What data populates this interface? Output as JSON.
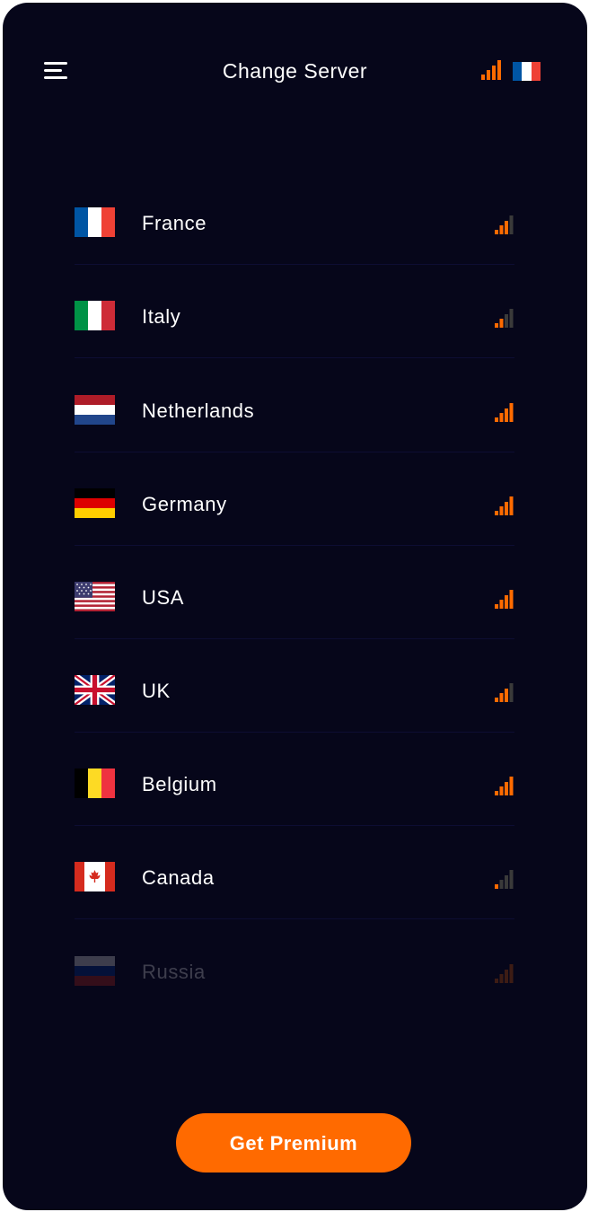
{
  "header": {
    "title": "Change Server",
    "menu_icon": "hamburger-menu-icon",
    "signal_icon": "signal-strength-icon",
    "current_flag": "France",
    "current_signal": 4
  },
  "servers": [
    {
      "country": "France",
      "flag": "france-flag-icon",
      "signal": 3
    },
    {
      "country": "Italy",
      "flag": "italy-flag-icon",
      "signal": 2
    },
    {
      "country": "Netherlands",
      "flag": "netherlands-flag-icon",
      "signal": 4
    },
    {
      "country": "Germany",
      "flag": "germany-flag-icon",
      "signal": 4
    },
    {
      "country": "USA",
      "flag": "usa-flag-icon",
      "signal": 4
    },
    {
      "country": "UK",
      "flag": "uk-flag-icon",
      "signal": 3
    },
    {
      "country": "Belgium",
      "flag": "belgium-flag-icon",
      "signal": 4
    },
    {
      "country": "Canada",
      "flag": "canada-flag-icon",
      "signal": 1
    },
    {
      "country": "Russia",
      "flag": "russia-flag-icon",
      "signal": 4
    }
  ],
  "cta": {
    "label": "Get Premium"
  },
  "colors": {
    "background": "#06061a",
    "accent": "#ff6a00",
    "signal_inactive": "#3a3a3a",
    "text": "#ffffff"
  }
}
